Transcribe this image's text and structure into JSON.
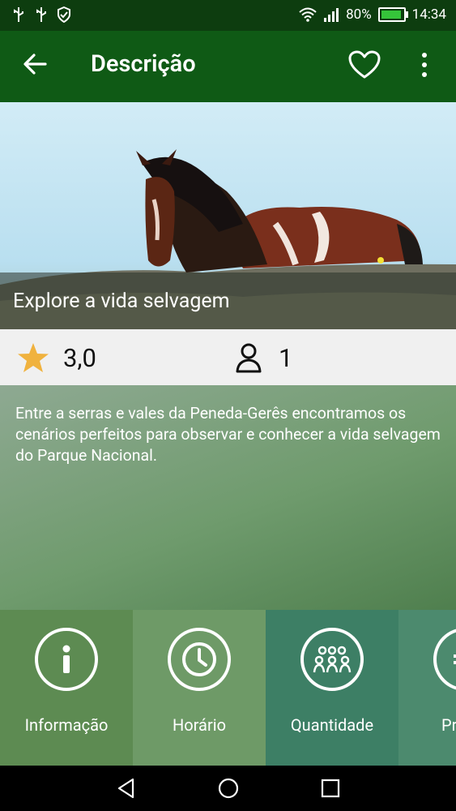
{
  "status_bar": {
    "battery_percent": "80%",
    "time": "14:34",
    "icons": [
      "usb-icon",
      "usb-icon",
      "shield-icon",
      "wifi-icon",
      "signal-icon",
      "battery-icon"
    ]
  },
  "app_bar": {
    "title": "Descrição",
    "icons": [
      "back-arrow-icon",
      "heart-icon",
      "more-vert-icon"
    ]
  },
  "hero": {
    "caption": "Explore a vida selvagem"
  },
  "stats": {
    "rating": "3,0",
    "participants": "1",
    "star_color": "#f0b23e"
  },
  "description": "Entre a serras e vales da Peneda-Gerês encontramos os cenários perfeitos para observar  e conhecer a vida selvagem do Parque Nacional.",
  "tiles": [
    {
      "label": "Informação",
      "icon": "info-icon"
    },
    {
      "label": "Horário",
      "icon": "clock-icon"
    },
    {
      "label": "Quantidade",
      "icon": "group-icon"
    },
    {
      "label": "Pr",
      "icon": "price-icon"
    }
  ],
  "colors": {
    "status_bar": "#0d3d0f",
    "app_bar": "#0f5a15",
    "accent_star": "#f0b23e"
  }
}
